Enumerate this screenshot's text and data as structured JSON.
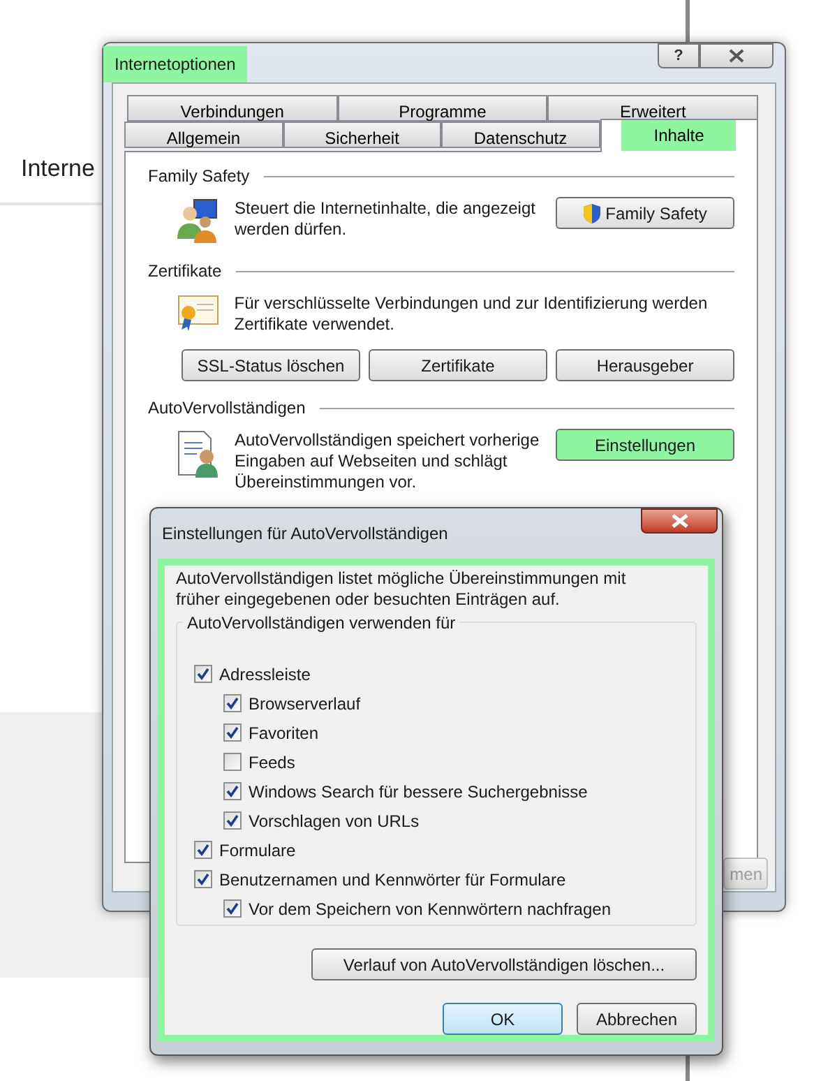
{
  "background_page": {
    "heading": "Interne"
  },
  "window": {
    "title": "Internetoptionen",
    "highlighted": true,
    "help_label": "?",
    "tab_rows": [
      [
        {
          "label": "Verbindungen",
          "selected": false,
          "highlighted": false
        },
        {
          "label": "Programme",
          "selected": false,
          "highlighted": false
        },
        {
          "label": "Erweitert",
          "selected": false,
          "highlighted": false
        }
      ],
      [
        {
          "label": "Allgemein",
          "selected": false,
          "highlighted": false
        },
        {
          "label": "Sicherheit",
          "selected": false,
          "highlighted": false
        },
        {
          "label": "Datenschutz",
          "selected": false,
          "highlighted": false
        },
        {
          "label": "Inhalte",
          "selected": true,
          "highlighted": true
        }
      ]
    ],
    "sections": [
      {
        "title": "Family Safety",
        "text": "Steuert die Internetinhalte, die angezeigt werden dürfen.",
        "side_button": {
          "label": "Family Safety",
          "shield": true,
          "highlighted": false
        }
      },
      {
        "title": "Zertifikate",
        "text": "Für verschlüsselte Verbindungen und zur Identifizierung werden Zertifikate verwendet.",
        "buttons": [
          "SSL-Status löschen",
          "Zertifikate",
          "Herausgeber"
        ]
      },
      {
        "title": "AutoVervollständigen",
        "text": "AutoVervollständigen speichert vorherige Eingaben auf Webseiten und schlägt Übereinstimmungen vor.",
        "side_button": {
          "label": "Einstellungen",
          "shield": false,
          "highlighted": true
        }
      }
    ],
    "covered_button": {
      "label": "men",
      "disabled": true
    }
  },
  "dialog": {
    "title": "Einstellungen für AutoVervollständigen",
    "highlighted": true,
    "intro": "AutoVervollständigen listet mögliche Übereinstimmungen mit früher eingegebenen oder besuchten Einträgen auf.",
    "group_title": "AutoVervollständigen verwenden für",
    "options": [
      {
        "label": "Adressleiste",
        "checked": true,
        "children": [
          {
            "label": "Browserverlauf",
            "checked": true
          },
          {
            "label": "Favoriten",
            "checked": true
          },
          {
            "label": "Feeds",
            "checked": false
          },
          {
            "label": "Windows Search für bessere Suchergebnisse",
            "checked": true
          },
          {
            "label": "Vorschlagen von URLs",
            "checked": true
          }
        ]
      },
      {
        "label": "Formulare",
        "checked": true
      },
      {
        "label": "Benutzernamen und Kennwörter für Formulare",
        "checked": true,
        "children": [
          {
            "label": "Vor dem Speichern von Kennwörtern nachfragen",
            "checked": true
          }
        ]
      }
    ],
    "clear_button": "Verlauf von AutoVervollständigen löschen...",
    "buttons": [
      {
        "label": "OK",
        "default": true
      },
      {
        "label": "Abbrechen",
        "default": false
      }
    ]
  }
}
